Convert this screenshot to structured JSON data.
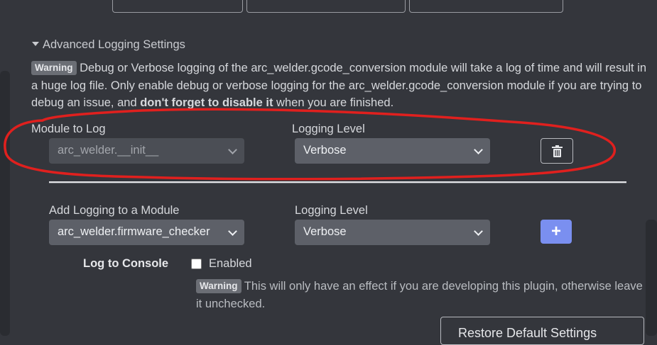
{
  "top_buttons": [
    {
      "icon": "download-icon"
    },
    {
      "icon": "file-icon"
    },
    {
      "icon": "folder-icon"
    }
  ],
  "advanced_section": {
    "toggle_label": "Advanced Logging Settings",
    "warning_badge": "Warning",
    "warning_text_1": " Debug or Verbose logging of the arc_welder.gcode_conversion module will take a log of time and will result in a huge log file. Only enable debug or verbose logging for the arc_welder.gcode_conversion module if you are trying to debug an issue, and ",
    "warning_bold": "don't forget to disable it",
    "warning_text_2": " when you are finished."
  },
  "existing_module": {
    "module_label": "Module to Log",
    "module_value": "arc_welder.__init__",
    "level_label": "Logging Level",
    "level_value": "Verbose",
    "delete_icon": "trash-icon"
  },
  "add_module": {
    "module_label": "Add Logging to a Module",
    "module_value": "arc_welder.firmware_checker",
    "level_label": "Logging Level",
    "level_value": "Verbose",
    "add_icon": "plus-icon"
  },
  "console": {
    "label": "Log to Console",
    "checkbox_label": "Enabled",
    "checked": false,
    "warning_badge": "Warning",
    "warning_text": " This will only have an effect if you are developing this plugin, otherwise leave it unchecked."
  },
  "restore_button": "Restore Default Settings",
  "colors": {
    "background": "#34363c",
    "select_bg": "#5d6068",
    "accent": "#7a8ff0",
    "annotation": "#e0201e"
  }
}
